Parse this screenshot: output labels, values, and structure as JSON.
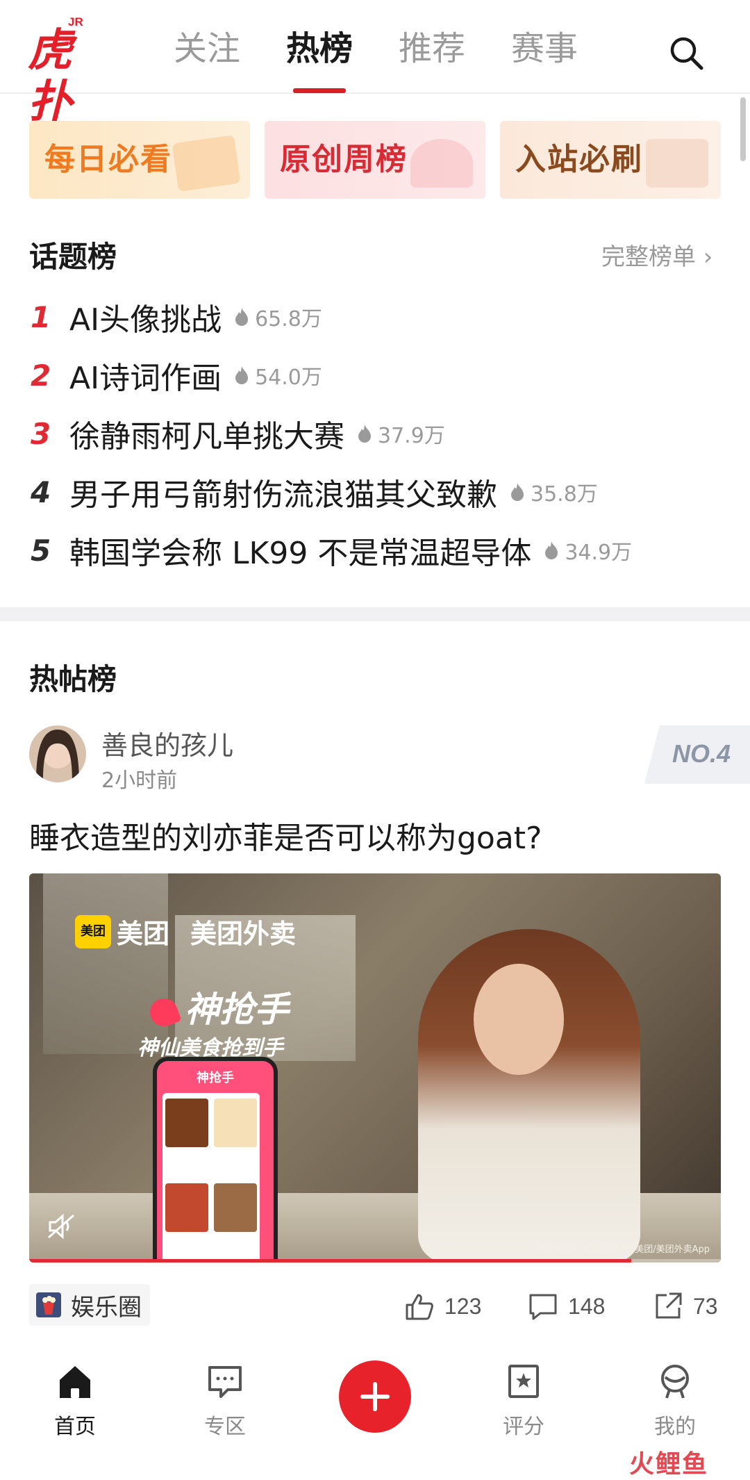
{
  "header": {
    "logo_text": "虎扑",
    "logo_badge": "JR",
    "tabs": [
      {
        "label": "关注"
      },
      {
        "label": "热榜"
      },
      {
        "label": "推荐"
      },
      {
        "label": "赛事"
      }
    ],
    "active_tab": "热榜"
  },
  "banners": [
    {
      "label": "每日必看"
    },
    {
      "label": "原创周榜"
    },
    {
      "label": "入站必刷"
    }
  ],
  "topics": {
    "title": "话题榜",
    "more_label": "完整榜单 ›",
    "items": [
      {
        "rank": "1",
        "title": "AI头像挑战",
        "heat": "65.8万"
      },
      {
        "rank": "2",
        "title": "AI诗词作画",
        "heat": "54.0万"
      },
      {
        "rank": "3",
        "title": "徐静雨柯凡单挑大赛",
        "heat": "37.9万"
      },
      {
        "rank": "4",
        "title": "男子用弓箭射伤流浪猫其父致歉",
        "heat": "35.8万"
      },
      {
        "rank": "5",
        "title": "韩国学会称 LK99 不是常温超导体",
        "heat": "34.9万"
      }
    ]
  },
  "hot_posts": {
    "title": "热帖榜",
    "post": {
      "author": "善良的孩儿",
      "time": "2小时前",
      "rank_badge": "NO.4",
      "title": "睡衣造型的刘亦菲是否可以称为goat?",
      "media": {
        "brand1_box": "美团",
        "brand1": "美团",
        "brand2": "美团外卖",
        "headline": "神抢手",
        "subline": "神仙美食抢到手",
        "phone_header": "神抢手",
        "disclaimer": "*具体活动时间及规则详见美团/美团外卖App",
        "progress": 0.87
      },
      "circle": "娱乐圈",
      "likes": "123",
      "comments": "148",
      "shares": "73"
    }
  },
  "bottom_nav": {
    "items": [
      {
        "label": "首页",
        "icon": "home-icon"
      },
      {
        "label": "专区",
        "icon": "zone-icon"
      },
      {
        "label": "评分",
        "icon": "rating-icon"
      },
      {
        "label": "我的",
        "icon": "profile-icon"
      }
    ],
    "active": "首页"
  },
  "watermark": "火鲤鱼",
  "colors": {
    "brand_red": "#e3202a",
    "rank_red": "#e02a33",
    "text_primary": "#1a1a1a",
    "text_muted": "#9a9a9a"
  }
}
